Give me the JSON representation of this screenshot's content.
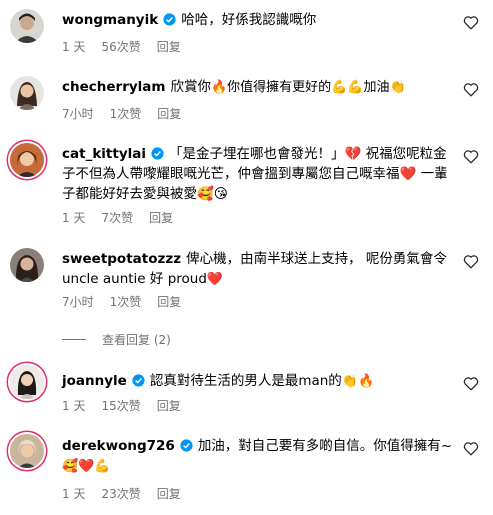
{
  "comments": [
    {
      "username": "wongmanyik",
      "verified": true,
      "text": "哈哈，好係我認識嘅你",
      "emojis": "",
      "time": "1 天",
      "likes": "56次赞",
      "reply": "回复"
    },
    {
      "username": "checherrylam",
      "verified": false,
      "text": "欣賞你",
      "emojis": "🔥你值得擁有更好的💪💪加油👏",
      "time": "7小时",
      "likes": "1次赞",
      "reply": "回复"
    },
    {
      "username": "cat_kittylai",
      "verified": true,
      "text": "「是金子埋在哪也會發光！」💔 祝福您呢粒金子不但為人帶嚟耀眼嘅光芒，仲會搵到專屬您自己嘅幸福❤️ 一輩子都能好好去愛與被愛🥰😘",
      "emojis": "",
      "time": "1 天",
      "likes": "7次赞",
      "reply": "回复"
    },
    {
      "username": "sweetpotatozzz",
      "verified": false,
      "text": "俾心機，由南半球送上支持， 呢份勇氣會令uncle auntie 好 proud",
      "emojis": "❤️",
      "time": "7小时",
      "likes": "1次赞",
      "reply": "回复"
    },
    {
      "username": "joannyle",
      "verified": true,
      "text": "認真對待生活的男人是最man的",
      "emojis": "👏🔥",
      "time": "1 天",
      "likes": "15次赞",
      "reply": "回复"
    },
    {
      "username": "derekwong726",
      "verified": true,
      "text": "加油，對自己要有多啲自信。你值得擁有~",
      "emojis": "🥰❤️💪",
      "time": "1 天",
      "likes": "23次赞",
      "reply": "回复"
    }
  ],
  "view_replies_label": "查看回复 (2)",
  "colors": {
    "verified": "#0095f6",
    "meta": "#737373",
    "like_heart": "#e0245e"
  }
}
